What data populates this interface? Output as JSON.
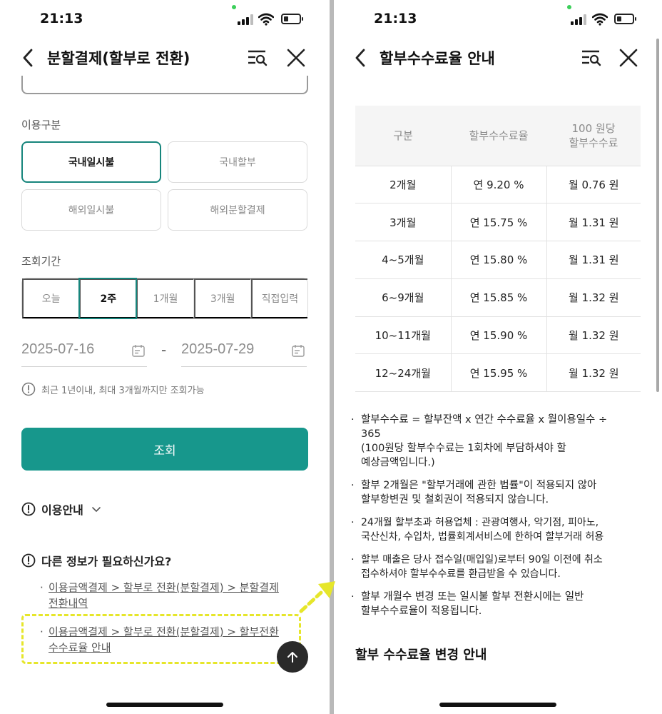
{
  "status_bar": {
    "time": "21:13"
  },
  "left": {
    "header": {
      "title": "분할결제(할부로 전환)"
    },
    "usage_type": {
      "label": "이용구분",
      "options": [
        "국내일시불",
        "국내할부",
        "해외일시불",
        "해외분할결제"
      ],
      "selected": "국내일시불"
    },
    "period": {
      "label": "조회기간",
      "options": [
        "오늘",
        "2주",
        "1개월",
        "3개월",
        "직접입력"
      ],
      "selected": "2주"
    },
    "dates": {
      "start": "2025-07-16",
      "separator": "-",
      "end": "2025-07-29"
    },
    "notice": "최근 1년이내, 최대 3개월까지만 조회가능",
    "inquiry_button": "조회",
    "usage_guide": "이용안내",
    "more_info": {
      "title": "다른 정보가 필요하신가요?",
      "links": [
        [
          "이용금액결제 > 할부로 전환(분할결제) > 분할결제",
          "전환내역"
        ],
        [
          "이용금액결제 > 할부로 전환(분할결제) > 할부전환",
          "수수료율 안내"
        ]
      ]
    }
  },
  "right": {
    "header": {
      "title": "할부수수료율 안내"
    },
    "table": {
      "headers": [
        "구분",
        "할부수수료율",
        "100 원당",
        "할부수수료"
      ],
      "rows": [
        [
          "2개월",
          "연 9.20 %",
          "월 0.76 원"
        ],
        [
          "3개월",
          "연 15.75 %",
          "월 1.31 원"
        ],
        [
          "4~5개월",
          "연 15.80 %",
          "월 1.31 원"
        ],
        [
          "6~9개월",
          "연 15.85 %",
          "월 1.32 원"
        ],
        [
          "10~11개월",
          "연 15.90 %",
          "월 1.32 원"
        ],
        [
          "12~24개월",
          "연 15.95 %",
          "월 1.32 원"
        ]
      ]
    },
    "notes": [
      [
        "할부수수료 = 할부잔액 x 연간 수수료율 x 월이용일수 ÷",
        "365",
        "(100원당 할부수수료는 1회차에 부담하셔야 할",
        "예상금액입니다.)"
      ],
      [
        "할부 2개월은 \"할부거래에 관한 법률\"이 적용되지 않아",
        "할부항변권 및 철회권이 적용되지 않습니다."
      ],
      [
        "24개월 할부초과 허용업체 : 관광여행사, 악기점, 피아노,",
        "국산신차, 수입차, 법률회계서비스에 한하여 할부거래 허용"
      ],
      [
        "할부 매출은 당사 접수일(매입일)로부터 90일 이전에 취소",
        "접수하셔야 할부수수료를 환급받을 수 있습니다."
      ],
      [
        "할부 개월수 변경 또는 일시불 할부 전환시에는 일반",
        "할부수수료율이 적용됩니다."
      ]
    ],
    "section_heading": "할부 수수료율 변경 안내"
  },
  "colors": {
    "accent": "#17978c",
    "highlight": "#e6e62a"
  }
}
